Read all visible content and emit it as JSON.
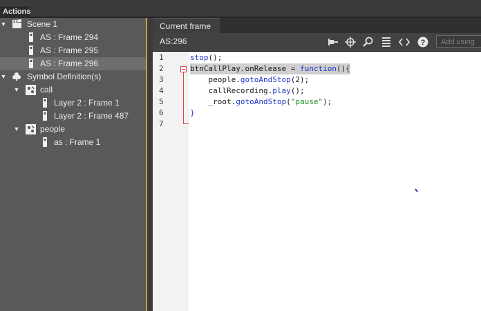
{
  "panel": {
    "tab_label": "Actions"
  },
  "tree": {
    "rows": [
      {
        "label": "Scene 1",
        "level": 0,
        "arrow": "▼",
        "icon": "clapper-icon",
        "selected": false
      },
      {
        "label": "AS : Frame 294",
        "level": 2,
        "arrow": "",
        "icon": "frame-icon",
        "selected": false
      },
      {
        "label": "AS : Frame 295",
        "level": 2,
        "arrow": "",
        "icon": "frame-icon",
        "selected": false
      },
      {
        "label": "AS : Frame 296",
        "level": 2,
        "arrow": "",
        "icon": "frame-icon",
        "selected": true
      },
      {
        "label": "Symbol Definition(s)",
        "level": 0,
        "arrow": "▼",
        "icon": "club-icon",
        "selected": false
      },
      {
        "label": "call",
        "level": 1,
        "arrow": "▼",
        "icon": "movieclip-icon",
        "selected": false
      },
      {
        "label": "Layer 2 : Frame 1",
        "level": 3,
        "arrow": "",
        "icon": "frame-icon",
        "selected": false
      },
      {
        "label": "Layer 2 : Frame 487",
        "level": 3,
        "arrow": "",
        "icon": "frame-icon",
        "selected": false
      },
      {
        "label": "people",
        "level": 1,
        "arrow": "▼",
        "icon": "movieclip-icon",
        "selected": false
      },
      {
        "label": "as : Frame 1",
        "level": 3,
        "arrow": "",
        "icon": "frame-icon",
        "selected": false
      }
    ]
  },
  "editor": {
    "tab_label": "Current frame",
    "location_label": "AS:296",
    "add_using_placeholder": "Add using",
    "tools": [
      "pin-icon",
      "target-icon",
      "magnifier-icon",
      "format-icon",
      "code-snippet-icon",
      "help-icon"
    ],
    "line_numbers": [
      "1",
      "2",
      "3",
      "4",
      "5",
      "6",
      "7"
    ],
    "code_lines": [
      [
        {
          "t": "stop",
          "c": "kw"
        },
        {
          "t": "();",
          "c": ""
        }
      ],
      [
        {
          "t": "btnCallPlay.onRelease = ",
          "c": ""
        },
        {
          "t": "function",
          "c": "kw"
        },
        {
          "t": "(){",
          "c": ""
        }
      ],
      [
        {
          "t": "    people.",
          "c": ""
        },
        {
          "t": "gotoAndStop",
          "c": "kw"
        },
        {
          "t": "(2);",
          "c": ""
        }
      ],
      [
        {
          "t": "    callRecording.",
          "c": ""
        },
        {
          "t": "play",
          "c": "kw"
        },
        {
          "t": "();",
          "c": ""
        }
      ],
      [
        {
          "t": "    _root.",
          "c": ""
        },
        {
          "t": "gotoAndStop",
          "c": "kw"
        },
        {
          "t": "(",
          "c": ""
        },
        {
          "t": "\"pause\"",
          "c": "str"
        },
        {
          "t": ");",
          "c": ""
        }
      ],
      [
        {
          "t": "}",
          "c": "kw"
        }
      ],
      []
    ]
  }
}
